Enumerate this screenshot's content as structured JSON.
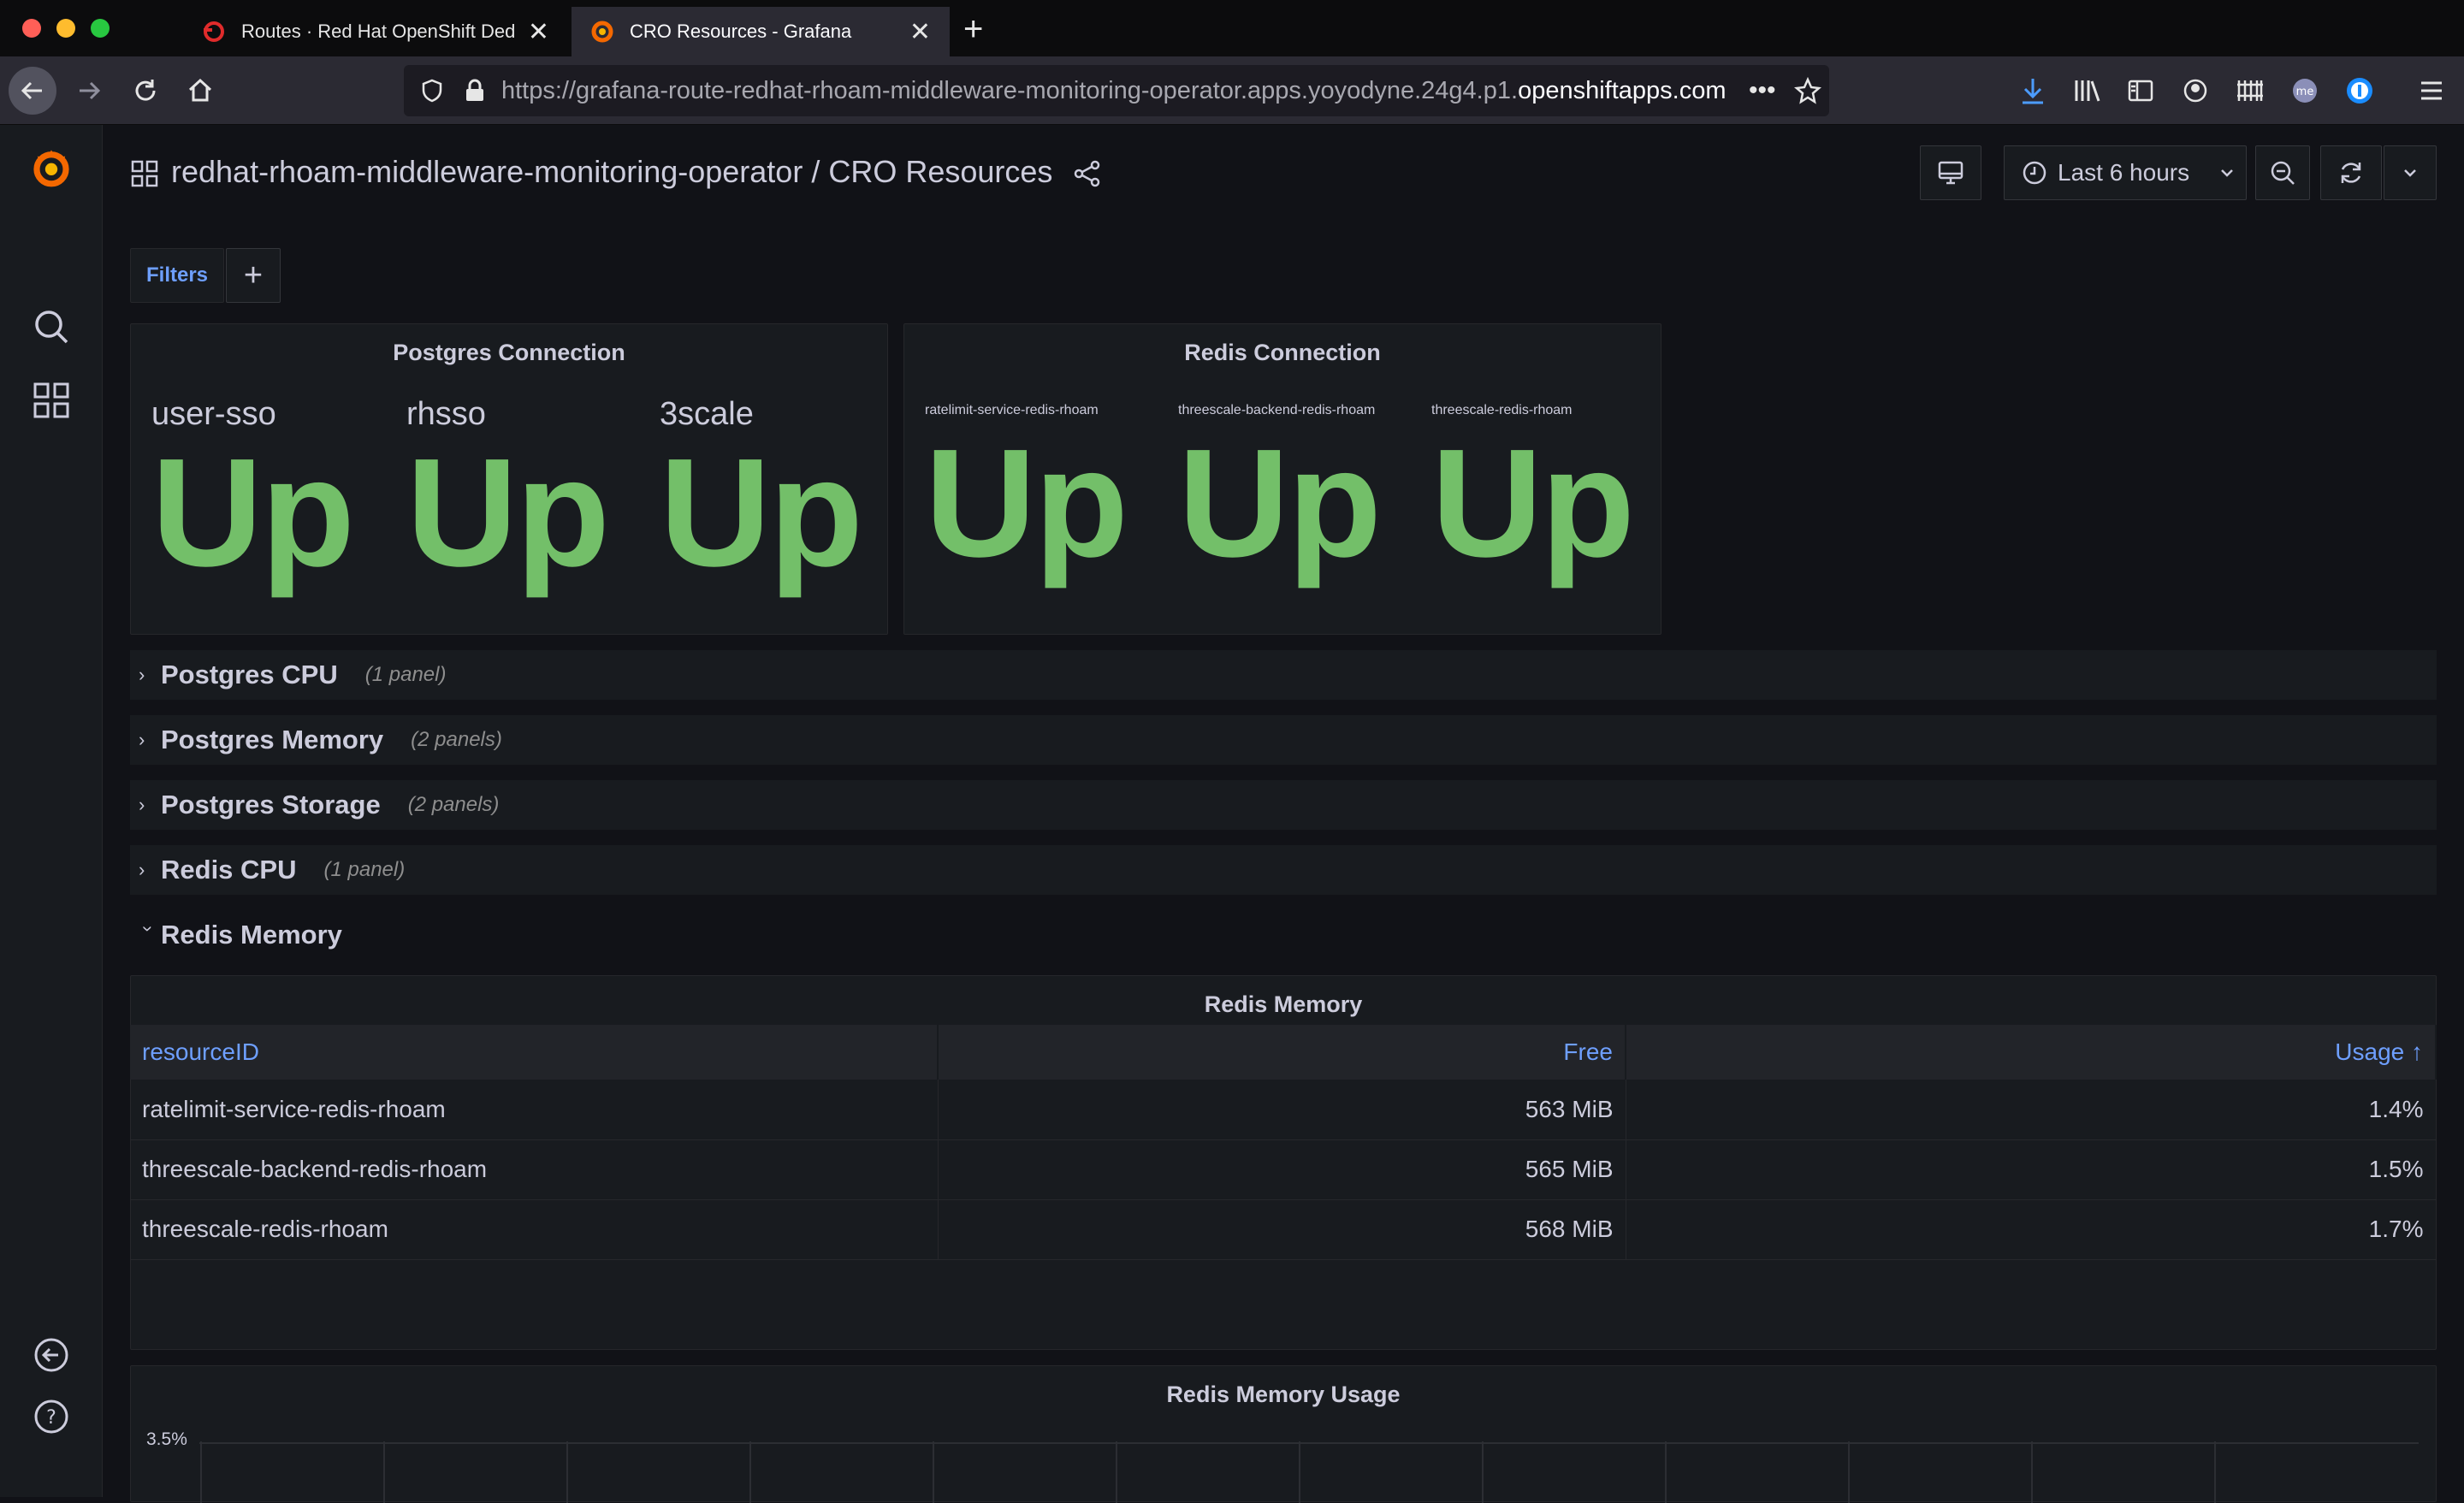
{
  "browser": {
    "tabs": [
      {
        "title": "Routes · Red Hat OpenShift Dedicated",
        "active": false
      },
      {
        "title": "CRO Resources - Grafana",
        "active": true
      }
    ],
    "url_main": "https://grafana-route-redhat-rhoam-middleware-monitoring-operator.apps.yoyodyne.24g4.p1.",
    "url_domain": "openshiftapps.com"
  },
  "dashboard": {
    "breadcrumb": "redhat-rhoam-middleware-monitoring-operator / CRO Resources",
    "time_range": "Last 6 hours",
    "filters_label": "Filters"
  },
  "postgres_panel": {
    "title": "Postgres Connection",
    "stats": [
      {
        "label": "user-sso",
        "value": "Up"
      },
      {
        "label": "rhsso",
        "value": "Up"
      },
      {
        "label": "3scale",
        "value": "Up"
      }
    ]
  },
  "redis_panel": {
    "title": "Redis Connection",
    "stats": [
      {
        "label": "ratelimit-service-redis-rhoam",
        "value": "Up"
      },
      {
        "label": "threescale-backend-redis-rhoam",
        "value": "Up"
      },
      {
        "label": "threescale-redis-rhoam",
        "value": "Up"
      }
    ]
  },
  "rows": [
    {
      "title": "Postgres CPU",
      "count": "(1 panel)"
    },
    {
      "title": "Postgres Memory",
      "count": "(2 panels)"
    },
    {
      "title": "Postgres Storage",
      "count": "(2 panels)"
    },
    {
      "title": "Redis CPU",
      "count": "(1 panel)"
    },
    {
      "title": "Redis Memory",
      "count": ""
    }
  ],
  "redis_memory_table": {
    "title": "Redis Memory",
    "headers": [
      "resourceID",
      "Free",
      "Usage ↑"
    ],
    "rows": [
      [
        "ratelimit-service-redis-rhoam",
        "563 MiB",
        "1.4%"
      ],
      [
        "threescale-backend-redis-rhoam",
        "565 MiB",
        "1.5%"
      ],
      [
        "threescale-redis-rhoam",
        "568 MiB",
        "1.7%"
      ]
    ]
  },
  "usage_chart": {
    "title": "Redis Memory Usage",
    "y_tick_top": "3.5%"
  },
  "colors": {
    "up_green": "#73bf69",
    "link_blue": "#6e9fff",
    "panel_bg": "#181b1f",
    "page_bg": "#111217"
  }
}
